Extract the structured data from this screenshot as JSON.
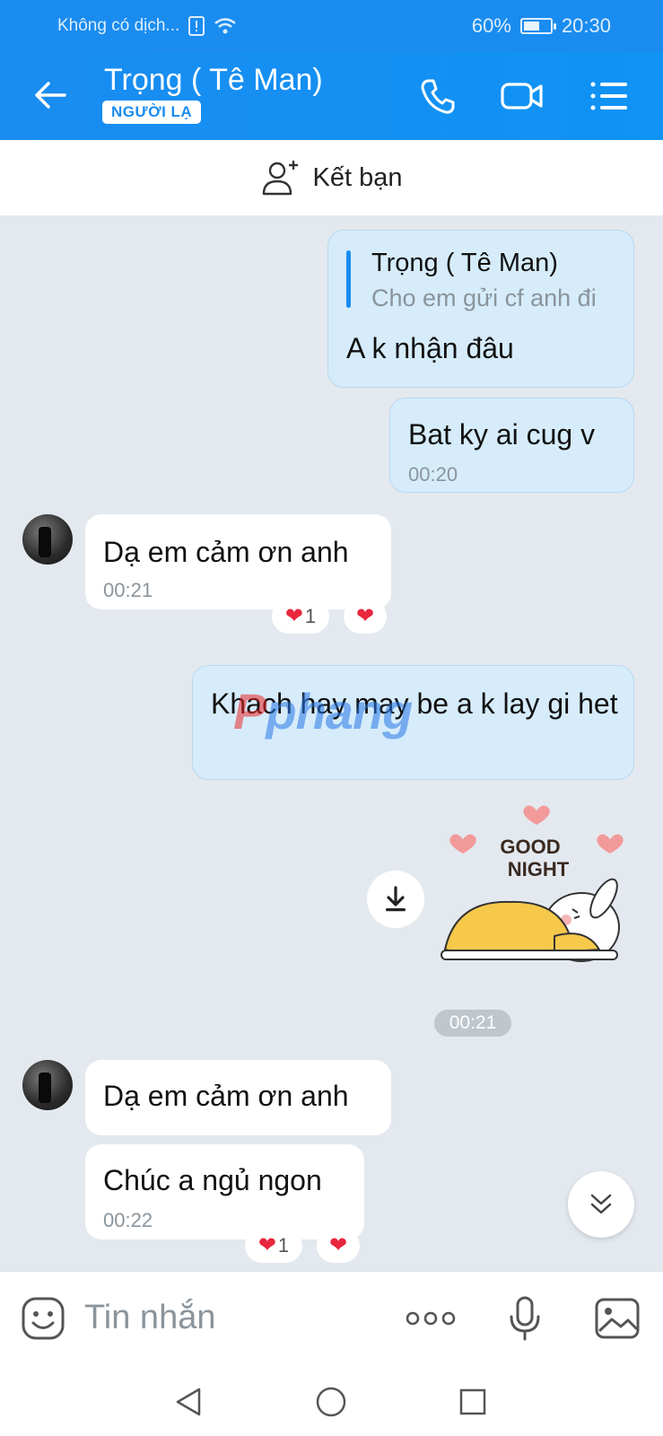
{
  "status_bar": {
    "carrier": "Không có dịch...",
    "battery": "60%",
    "battery_level": 0.6,
    "time": "20:30"
  },
  "header": {
    "title": "Trọng ( Tê Man)",
    "badge": "NGƯỜI LẠ"
  },
  "add_friend": {
    "label": "Kết bạn"
  },
  "messages": {
    "m1": {
      "quote_author": "Trọng ( Tê Man)",
      "quote_text": "Cho em gửi cf anh đi",
      "text": "A k nhận đâu"
    },
    "m2": {
      "text": "Bat ky ai cug v",
      "time": "00:20"
    },
    "m3": {
      "text": "Dạ em cảm ơn anh",
      "time": "00:21",
      "reaction_count": "1"
    },
    "m4": {
      "text": "Khach hay may be a k lay gi het"
    },
    "sticker": {
      "line1": "GOOD",
      "line2": "NIGHT",
      "time": "00:21"
    },
    "m5": {
      "text": "Dạ em cảm ơn anh"
    },
    "m6": {
      "text": "Chúc a ngủ ngon",
      "time": "00:22",
      "reaction_count": "1"
    }
  },
  "input": {
    "placeholder": "Tin nhắn"
  },
  "watermark": {
    "part1": "P",
    "part2": "phang"
  },
  "colors": {
    "header": "#1a8cf0",
    "my_bubble": "#d6ecfb",
    "background": "#e3e9ef",
    "heart": "#e8263d"
  },
  "icons": [
    "back-arrow-icon",
    "phone-icon",
    "video-call-icon",
    "menu-icon",
    "add-friend-icon",
    "download-icon",
    "scroll-down-icon",
    "emoji-icon",
    "more-icon",
    "microphone-icon",
    "image-icon",
    "nav-back-icon",
    "nav-home-icon",
    "nav-recents-icon"
  ]
}
